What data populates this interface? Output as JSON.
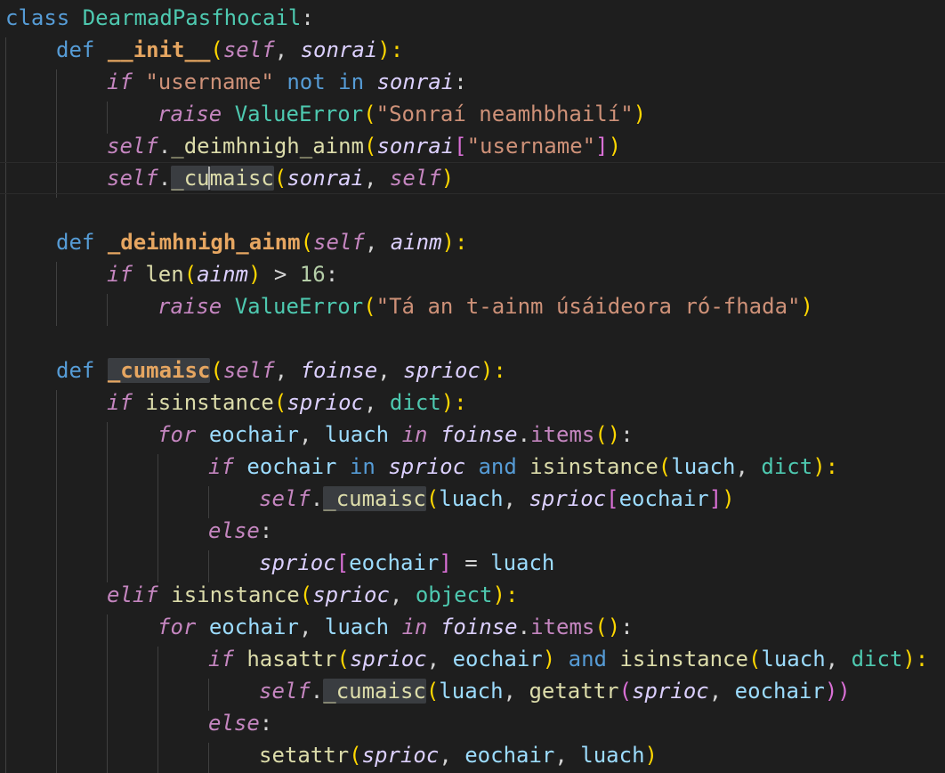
{
  "editor": {
    "language": "python",
    "accent_colors": {
      "keyword": "#569cd6",
      "control": "#c586c0",
      "class_name": "#4ec9b0",
      "function": "#dcdcaa",
      "string": "#ce9178",
      "number": "#b5cea8"
    },
    "lines": {
      "l01": {
        "a": "class",
        "b": " ",
        "c": "DearmadPasfhocail",
        "d": ":"
      },
      "l02": {
        "a": "def",
        "b": " ",
        "c": "__init__",
        "d": "(",
        "e": "self",
        "f": ", ",
        "g": "sonrai",
        "h": "):"
      },
      "l03": {
        "a": "if",
        "b": " ",
        "c": "\"username\"",
        "d": " ",
        "e": "not",
        "f": " ",
        "g": "in",
        "h": " ",
        "i": "sonrai",
        "j": ":"
      },
      "l04": {
        "a": "raise",
        "b": " ",
        "c": "ValueError",
        "d": "(",
        "e": "\"Sonraí neamhbhailí\"",
        "f": ")"
      },
      "l05": {
        "a": "self",
        "b": ".",
        "c": "_deimhnigh_ainm",
        "d": "(",
        "e": "sonrai",
        "f": "[",
        "g": "\"username\"",
        "h": "]",
        "i": ")"
      },
      "l06": {
        "a": "self",
        "b": ".",
        "c": "_cu",
        "d": "maisc",
        "e": "(",
        "f": "sonrai",
        "g": ", ",
        "h": "self",
        "i": ")"
      },
      "l08": {
        "a": "def",
        "b": " ",
        "c": "_deimhnigh_ainm",
        "d": "(",
        "e": "self",
        "f": ", ",
        "g": "ainm",
        "h": "):"
      },
      "l09": {
        "a": "if",
        "b": " ",
        "c": "len",
        "d": "(",
        "e": "ainm",
        "f": ")",
        "g": " > ",
        "h": "16",
        "i": ":"
      },
      "l10": {
        "a": "raise",
        "b": " ",
        "c": "ValueError",
        "d": "(",
        "e": "\"Tá an t-ainm úsáideora ró-fhada\"",
        "f": ")"
      },
      "l12": {
        "a": "def",
        "b": " ",
        "c": "_cumaisc",
        "d": "(",
        "e": "self",
        "f": ", ",
        "g": "foinse",
        "h": ", ",
        "i": "sprioc",
        "j": "):"
      },
      "l13": {
        "a": "if",
        "b": " ",
        "c": "isinstance",
        "d": "(",
        "e": "sprioc",
        "f": ", ",
        "g": "dict",
        "h": "):"
      },
      "l14": {
        "a": "for",
        "b": " ",
        "c": "eochair",
        "d": ", ",
        "e": "luach",
        "f": " ",
        "g": "in",
        "h": " ",
        "i": "foinse",
        "j": ".",
        "k": "items",
        "l": "()",
        "m": ":"
      },
      "l15": {
        "a": "if",
        "b": " ",
        "c": "eochair",
        "d": " ",
        "e": "in",
        "f": " ",
        "g": "sprioc",
        "h": " ",
        "i": "and",
        "j": " ",
        "k": "isinstance",
        "l": "(",
        "m": "luach",
        "n": ", ",
        "o": "dict",
        "p": "):"
      },
      "l16": {
        "a": "self",
        "b": ".",
        "c": "_cumaisc",
        "d": "(",
        "e": "luach",
        "f": ", ",
        "g": "sprioc",
        "h": "[",
        "i": "eochair",
        "j": "]",
        "k": ")"
      },
      "l17": {
        "a": "else",
        "b": ":"
      },
      "l18": {
        "a": "sprioc",
        "b": "[",
        "c": "eochair",
        "d": "]",
        "e": " = ",
        "f": "luach"
      },
      "l19": {
        "a": "elif",
        "b": " ",
        "c": "isinstance",
        "d": "(",
        "e": "sprioc",
        "f": ", ",
        "g": "object",
        "h": "):"
      },
      "l20": {
        "a": "for",
        "b": " ",
        "c": "eochair",
        "d": ", ",
        "e": "luach",
        "f": " ",
        "g": "in",
        "h": " ",
        "i": "foinse",
        "j": ".",
        "k": "items",
        "l": "()",
        "m": ":"
      },
      "l21": {
        "a": "if",
        "b": " ",
        "c": "hasattr",
        "d": "(",
        "e": "sprioc",
        "f": ", ",
        "g": "eochair",
        "h": ")",
        "i": " ",
        "j": "and",
        "k": " ",
        "l": "isinstance",
        "m": "(",
        "n": "luach",
        "o": ", ",
        "p": "dict",
        "q": "):"
      },
      "l22": {
        "a": "self",
        "b": ".",
        "c": "_cumaisc",
        "d": "(",
        "e": "luach",
        "f": ", ",
        "g": "getattr",
        "h": "(",
        "i": "sprioc",
        "j": ", ",
        "k": "eochair",
        "l": "))"
      },
      "l23": {
        "a": "else",
        "b": ":"
      },
      "l24": {
        "a": "setattr",
        "b": "(",
        "c": "sprioc",
        "d": ", ",
        "e": "eochair",
        "f": ", ",
        "g": "luach",
        "h": ")"
      }
    }
  }
}
